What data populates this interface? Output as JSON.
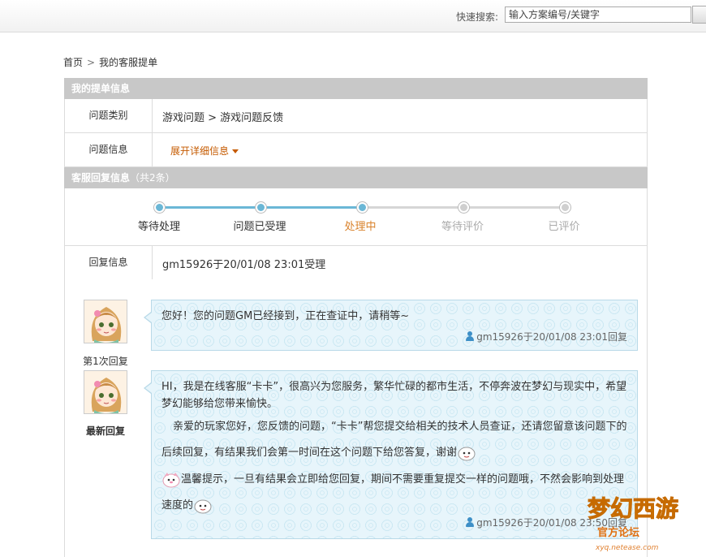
{
  "header": {
    "search_label": "快速搜索:",
    "search_placeholder": "输入方案编号/关键字"
  },
  "breadcrumb": {
    "home": "首页",
    "separator": ">",
    "current": "我的客服提单"
  },
  "ticket_info": {
    "title": "我的提单信息",
    "category_label": "问题类别",
    "category_value": "游戏问题 > 游戏问题反馈",
    "info_label": "问题信息",
    "expand_link": "展开详细信息"
  },
  "reply_info": {
    "title": "客服回复信息",
    "count": "（共2条）",
    "steps": [
      {
        "label": "等待处理",
        "state": "done"
      },
      {
        "label": "问题已受理",
        "state": "done"
      },
      {
        "label": "处理中",
        "state": "current"
      },
      {
        "label": "等待评价",
        "state": "pending"
      },
      {
        "label": "已评价",
        "state": "pending"
      }
    ],
    "reply_label": "回复信息",
    "reply_value": "gm15926于20/01/08 23:01受理"
  },
  "replies": [
    {
      "caption": "第1次回复",
      "text": "您好！您的问题GM已经接到，正在查证中，请稍等~",
      "meta": "gm15926于20/01/08 23:01回复"
    },
    {
      "caption": "最新回复",
      "line1": "HI，我是在线客服“卡卡”，很高兴为您服务，繁华忙碌的都市生活，不停奔波在梦幻与现实中，希望梦幻能够给您带来愉快。",
      "line2": "亲爱的玩家您好，您反馈的问题，“卡卡”帮您提交给相关的技术人员查证，还请您留意该问题下的后续回复，有结果我们会第一时间在这个问题下给您答复，谢谢",
      "line3": "温馨提示，一旦有结果会立即给您回复，期间不需要重复提交一样的问题哦，不然会影响到处理速度的",
      "meta": "gm15926于20/01/08 23:50回复"
    }
  ],
  "watermark": {
    "text": "梦幻西游",
    "subtext": "官方论坛",
    "url": "xyq.netease.com"
  },
  "colors": {
    "accent_orange": "#c55a00",
    "progress_done": "#6bb7d6",
    "progress_pending": "#cccccc",
    "header_gray": "#c8c8c8",
    "bubble_bg": "#e7f5fb"
  }
}
